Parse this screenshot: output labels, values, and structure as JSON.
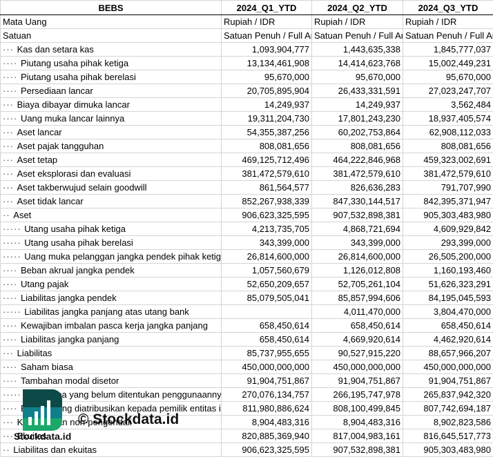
{
  "header": {
    "label": "BEBS",
    "periods": [
      "2024_Q1_YTD",
      "2024_Q2_YTD",
      "2024_Q3_YTD"
    ]
  },
  "meta_rows": [
    {
      "label": "Mata Uang",
      "values": [
        "Rupiah / IDR",
        "Rupiah / IDR",
        "Rupiah / IDR"
      ]
    },
    {
      "label": "Satuan",
      "values": [
        "Satuan Penuh / Full Amount",
        "Satuan Penuh / Full Amount",
        "Satuan Penuh / Full Amount"
      ]
    }
  ],
  "rows": [
    {
      "indent": 3,
      "label": "Kas dan setara kas",
      "values": [
        "1,093,904,777",
        "1,443,635,338",
        "1,845,777,037"
      ]
    },
    {
      "indent": 4,
      "label": "Piutang usaha pihak ketiga",
      "values": [
        "13,134,461,908",
        "14,414,623,768",
        "15,002,449,231"
      ]
    },
    {
      "indent": 4,
      "label": "Piutang usaha pihak berelasi",
      "values": [
        "95,670,000",
        "95,670,000",
        "95,670,000"
      ]
    },
    {
      "indent": 4,
      "label": "Persediaan lancar",
      "values": [
        "20,705,895,904",
        "26,433,331,591",
        "27,023,247,707"
      ]
    },
    {
      "indent": 3,
      "label": "Biaya dibayar dimuka lancar",
      "values": [
        "14,249,937",
        "14,249,937",
        "3,562,484"
      ]
    },
    {
      "indent": 4,
      "label": "Uang muka lancar lainnya",
      "values": [
        "19,311,204,730",
        "17,801,243,230",
        "18,937,405,574"
      ]
    },
    {
      "indent": 3,
      "label": "Aset lancar",
      "values": [
        "54,355,387,256",
        "60,202,753,864",
        "62,908,112,033"
      ]
    },
    {
      "indent": 3,
      "label": "Aset pajak tangguhan",
      "values": [
        "808,081,656",
        "808,081,656",
        "808,081,656"
      ]
    },
    {
      "indent": 3,
      "label": "Aset tetap",
      "values": [
        "469,125,712,496",
        "464,222,846,968",
        "459,323,002,691"
      ]
    },
    {
      "indent": 3,
      "label": "Aset eksplorasi dan evaluasi",
      "values": [
        "381,472,579,610",
        "381,472,579,610",
        "381,472,579,610"
      ]
    },
    {
      "indent": 3,
      "label": "Aset takberwujud selain goodwill",
      "values": [
        "861,564,577",
        "826,636,283",
        "791,707,990"
      ]
    },
    {
      "indent": 3,
      "label": "Aset tidak lancar",
      "values": [
        "852,267,938,339",
        "847,330,144,517",
        "842,395,371,947"
      ]
    },
    {
      "indent": 2,
      "label": "Aset",
      "values": [
        "906,623,325,595",
        "907,532,898,381",
        "905,303,483,980"
      ]
    },
    {
      "indent": 5,
      "label": "Utang usaha pihak ketiga",
      "values": [
        "4,213,735,705",
        "4,868,721,694",
        "4,609,929,842"
      ]
    },
    {
      "indent": 5,
      "label": "Utang usaha pihak berelasi",
      "values": [
        "343,399,000",
        "343,399,000",
        "293,399,000"
      ]
    },
    {
      "indent": 5,
      "label": "Uang muka pelanggan jangka pendek pihak ketiga",
      "values": [
        "26,814,600,000",
        "26,814,600,000",
        "26,505,200,000"
      ]
    },
    {
      "indent": 4,
      "label": "Beban akrual jangka pendek",
      "values": [
        "1,057,560,679",
        "1,126,012,808",
        "1,160,193,460"
      ]
    },
    {
      "indent": 4,
      "label": "Utang pajak",
      "values": [
        "52,650,209,657",
        "52,705,261,104",
        "51,626,323,291"
      ]
    },
    {
      "indent": 4,
      "label": "Liabilitas jangka pendek",
      "values": [
        "85,079,505,041",
        "85,857,994,606",
        "84,195,045,593"
      ]
    },
    {
      "indent": 5,
      "label": "Liabilitas jangka panjang atas utang bank",
      "values": [
        "",
        "4,011,470,000",
        "3,804,470,000"
      ]
    },
    {
      "indent": 4,
      "label": "Kewajiban imbalan pasca kerja jangka panjang",
      "values": [
        "658,450,614",
        "658,450,614",
        "658,450,614"
      ]
    },
    {
      "indent": 4,
      "label": "Liabilitas jangka panjang",
      "values": [
        "658,450,614",
        "4,669,920,614",
        "4,462,920,614"
      ]
    },
    {
      "indent": 3,
      "label": "Liabilitas",
      "values": [
        "85,737,955,655",
        "90,527,915,220",
        "88,657,966,207"
      ]
    },
    {
      "indent": 4,
      "label": "Saham biasa",
      "values": [
        "450,000,000,000",
        "450,000,000,000",
        "450,000,000,000"
      ]
    },
    {
      "indent": 4,
      "label": "Tambahan modal disetor",
      "values": [
        "91,904,751,867",
        "91,904,751,867",
        "91,904,751,867"
      ]
    },
    {
      "indent": 5,
      "label": "Saldo laba yang belum ditentukan penggunaannya",
      "values": [
        "270,076,134,757",
        "266,195,747,978",
        "265,837,942,320"
      ]
    },
    {
      "indent": 4,
      "label": "Ekuitas yang diatribusikan kepada pemilik entitas induk",
      "values": [
        "811,980,886,624",
        "808,100,499,845",
        "807,742,694,187"
      ]
    },
    {
      "indent": 3,
      "label": "Kepentingan non-pengendali",
      "values": [
        "8,904,483,316",
        "8,904,483,316",
        "8,902,823,586"
      ]
    },
    {
      "indent": 3,
      "label": "Ekuitas",
      "values": [
        "820,885,369,940",
        "817,004,983,161",
        "816,645,517,773"
      ]
    },
    {
      "indent": 2,
      "label": "Liabilitas dan ekuitas",
      "values": [
        "906,623,325,595",
        "907,532,898,381",
        "905,303,483,980"
      ]
    }
  ],
  "watermark": {
    "text": "© Stockdata.id",
    "logo_text": "Stockdata.id",
    "colors": {
      "dark": "#0d4a47",
      "mid": "#0f7f8c",
      "green": "#1aa86b"
    }
  }
}
